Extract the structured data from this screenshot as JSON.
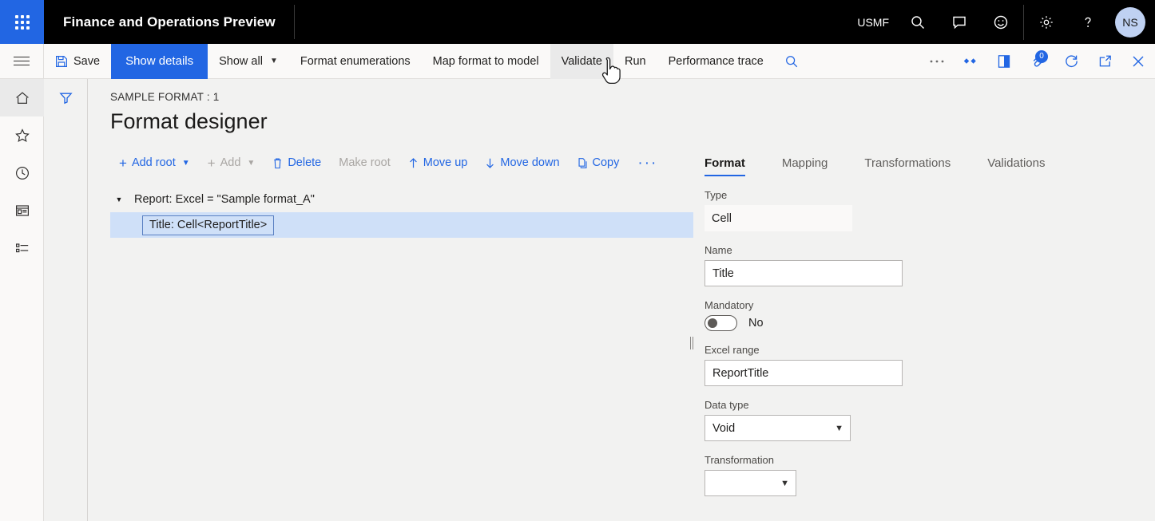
{
  "topnav": {
    "app_title": "Finance and Operations Preview",
    "company": "USMF",
    "icons": [
      "search-icon",
      "message-icon",
      "smiley-icon",
      "gear-icon",
      "help-icon"
    ],
    "avatar_initials": "NS",
    "background": "#000000",
    "waffle_color": "#2266e3"
  },
  "commandbar": {
    "save_label": "Save",
    "show_details_label": "Show details",
    "show_all_label": "Show all",
    "format_enumerations_label": "Format enumerations",
    "map_format_label": "Map format to model",
    "validate_label": "Validate",
    "run_label": "Run",
    "performance_trace_label": "Performance trace",
    "attachment_badge": "0",
    "accent": "#2266e3"
  },
  "rail": {
    "items": [
      {
        "name": "home-icon",
        "active": true
      },
      {
        "name": "favorites-star-icon",
        "active": false
      },
      {
        "name": "recent-clock-icon",
        "active": false
      },
      {
        "name": "workspaces-icon",
        "active": false
      },
      {
        "name": "modules-list-icon",
        "active": false
      }
    ]
  },
  "filter_column": {
    "icon": "filter-funnel-icon"
  },
  "page": {
    "caption": "SAMPLE FORMAT : 1",
    "title": "Format designer"
  },
  "tree_toolbar": {
    "add_root_label": "Add root",
    "add_label": "Add",
    "delete_label": "Delete",
    "make_root_label": "Make root",
    "move_up_label": "Move up",
    "move_down_label": "Move down",
    "copy_label": "Copy",
    "overflow_label": "···"
  },
  "tree": {
    "root_label": "Report: Excel = \"Sample format_A\"",
    "child_label": "Title: Cell<ReportTitle>",
    "selected_row": "Title: Cell<ReportTitle>",
    "selection_bg": "#cfe0f8"
  },
  "detail": {
    "tabs": [
      {
        "label": "Format",
        "active": true
      },
      {
        "label": "Mapping",
        "active": false
      },
      {
        "label": "Transformations",
        "active": false
      },
      {
        "label": "Validations",
        "active": false
      }
    ],
    "fields": {
      "type_label": "Type",
      "type_value": "Cell",
      "name_label": "Name",
      "name_value": "Title",
      "mandatory_label": "Mandatory",
      "mandatory_value": "No",
      "excel_range_label": "Excel range",
      "excel_range_value": "ReportTitle",
      "data_type_label": "Data type",
      "data_type_value": "Void",
      "transformation_label": "Transformation",
      "transformation_value": ""
    }
  }
}
